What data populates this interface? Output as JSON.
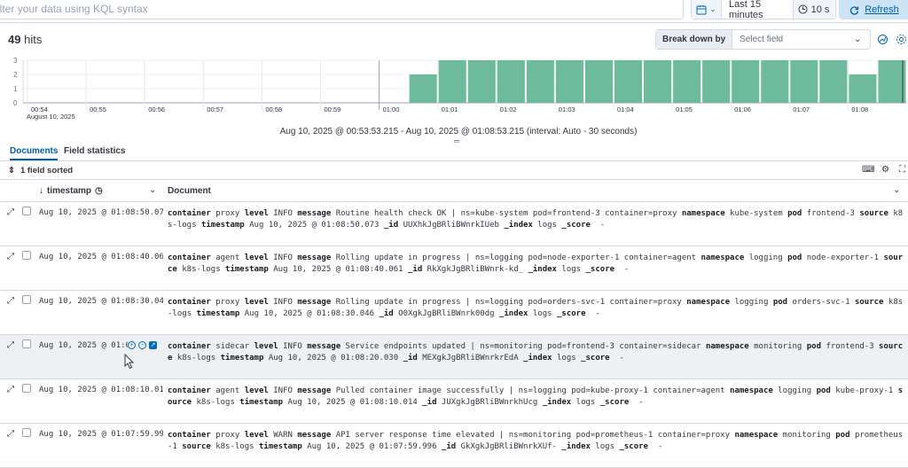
{
  "query_bar": {
    "placeholder": "ilter your data using KQL syntax"
  },
  "date_picker": {
    "label": "Last 15 minutes",
    "interval": "10 s"
  },
  "refresh": {
    "label": "Refresh"
  },
  "hits": {
    "count": "49",
    "label": "hits"
  },
  "breakdown": {
    "label": "Break down by",
    "placeholder": "Select field"
  },
  "chart_data": {
    "type": "bar",
    "y_ticks": [
      "0",
      "1",
      "2",
      "3"
    ],
    "ylim": [
      0,
      3
    ],
    "x_ticks": [
      "00:54",
      "00:55",
      "00:56",
      "00:57",
      "00:58",
      "00:59",
      "01:00",
      "01:01",
      "01:02",
      "01:03",
      "01:04",
      "01:05",
      "01:06",
      "01:07",
      "01:08"
    ],
    "x_sub_label": "August 10, 2025",
    "bar_color": "#6dbb9c",
    "values": [
      0,
      0,
      0,
      0,
      0,
      0,
      0,
      0,
      0,
      0,
      0,
      0,
      0,
      0,
      2,
      3,
      3,
      3,
      3,
      3,
      3,
      3,
      3,
      3,
      3,
      3,
      3,
      3,
      3,
      2,
      3
    ]
  },
  "time_range": "Aug 10, 2025 @ 00:53:53.215 - Aug 10, 2025 @ 01:08:53.215 (interval: Auto - 30 seconds)",
  "tabs": [
    {
      "label": "Documents"
    },
    {
      "label": "Field statistics"
    }
  ],
  "sort_info": "1 field sorted",
  "columns": {
    "timestamp": "timestamp",
    "document": "Document"
  },
  "rows": [
    {
      "timestamp": "Aug 10, 2025 @ 01:08:50.073",
      "container": "proxy",
      "level": "INFO",
      "message": "Routine health check OK | ns=kube-system pod=frontend-3 container=proxy",
      "namespace": "kube-system",
      "pod": "frontend-3",
      "source": "k8s-log",
      "wrap": "s",
      "ts": "Aug 10, 2025 @ 01:08:50.073",
      "id": "UUXhkJgBRliBWnrkIUeb",
      "index": "logs",
      "score": "-"
    },
    {
      "timestamp": "Aug 10, 2025 @ 01:08:40.061",
      "container": "agent",
      "level": "INFO",
      "message": "Rolling update in progress | ns=logging pod=node-exporter-1 container=agent",
      "namespace": "logging",
      "pod": "node-exporter-1",
      "source": "k8s-log",
      "wrap": "s",
      "ts": "Aug 10, 2025 @ 01:08:40.061",
      "id": "RkXgkJgBRliBWnrk-kd_",
      "index": "logs",
      "score": "-"
    },
    {
      "timestamp": "Aug 10, 2025 @ 01:08:30.046",
      "container": "proxy",
      "level": "INFO",
      "message": "Rolling update in progress | ns=logging pod=orders-svc-1 container=proxy",
      "namespace": "logging",
      "pod": "orders-svc-1",
      "source": "k8s-log",
      "wrap": "s",
      "ts": "Aug 10, 2025 @ 01:08:30.046",
      "id": "O0XgkJgBRliBWnrk00dg",
      "index": "logs",
      "score": "-"
    },
    {
      "timestamp": "Aug 10, 2025 @ 01:08",
      "container": "sidecar",
      "level": "INFO",
      "message": "Service endpoints updated | ns=monitoring pod=frontend-3 container=sidecar",
      "namespace": "monitoring",
      "pod": "frontend-3",
      "source": "k8s-log",
      "wrap": "s",
      "ts": "Aug 10, 2025 @ 01:08:20.030",
      "id": "MEXgkJgBRliBWnrkrEdA",
      "index": "logs",
      "score": "-"
    },
    {
      "timestamp": "Aug 10, 2025 @ 01:08:10.014",
      "container": "agent",
      "level": "INFO",
      "message": "Pulled container image successfully | ns=logging pod=kube-proxy-1 container=agent",
      "namespace": "logging",
      "pod": "kube-proxy-1",
      "source": "k8s-log",
      "wrap": "s",
      "ts": "Aug 10, 2025 @ 01:08:10.014",
      "id": "JUXgkJgBRliBWnrkhUcg",
      "index": "logs",
      "score": "-"
    },
    {
      "timestamp": "Aug 10, 2025 @ 01:07:59.996",
      "container": "proxy",
      "level": "WARN",
      "message": "API server response time elevated | ns=monitoring pod=prometheus-1 container=proxy",
      "namespace": "monitoring",
      "pod": "prometheus-1",
      "source": "k8s",
      "wrap": "-logs",
      "ts": "Aug 10, 2025 @ 01:07:59.996",
      "id": "GkXgkJgBRliBWnrkXUf-",
      "index": "logs",
      "score": "-"
    }
  ],
  "field_keys": {
    "container": "container",
    "level": "level",
    "message": "message",
    "namespace": "namespace",
    "pod": "pod",
    "source": "source",
    "timestamp": "timestamp",
    "id": "_id",
    "index": "_index",
    "score": "_score"
  }
}
